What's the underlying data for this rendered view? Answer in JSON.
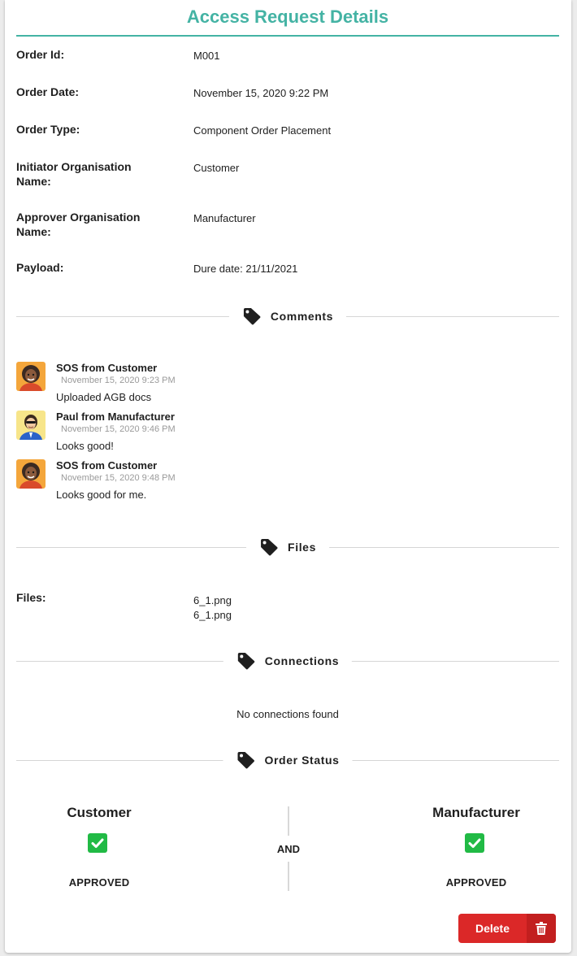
{
  "page": {
    "title": "Access Request Details"
  },
  "details": [
    {
      "label": "Order Id:",
      "value": "M001"
    },
    {
      "label": "Order Date:",
      "value": "November 15, 2020 9:22 PM"
    },
    {
      "label": "Order Type:",
      "value": "Component Order Placement"
    },
    {
      "label": "Initiator Organisation Name:",
      "value": "Customer"
    },
    {
      "label": "Approver Organisation Name:",
      "value": "Manufacturer"
    },
    {
      "label": "Payload:",
      "value": "Dure date: 21/11/2021"
    }
  ],
  "comments_section": {
    "label": "Comments",
    "icon": "tag-icon",
    "items": [
      {
        "author": "SOS from Customer",
        "date": "November 15, 2020 9:23 PM",
        "text": "Uploaded AGB docs",
        "avatar": "avatar-customer"
      },
      {
        "author": "Paul from Manufacturer",
        "date": "November 15, 2020 9:46 PM",
        "text": "Looks good!",
        "avatar": "avatar-manufacturer"
      },
      {
        "author": "SOS from Customer",
        "date": "November 15, 2020 9:48 PM",
        "text": "Looks good for me.",
        "avatar": "avatar-customer"
      }
    ]
  },
  "files_section": {
    "label": "Files",
    "icon": "tag-icon",
    "field_label": "Files:",
    "items": [
      "6_1.png",
      "6_1.png"
    ]
  },
  "connections_section": {
    "label": "Connections",
    "icon": "tag-icon",
    "empty_text": "No connections found"
  },
  "status_section": {
    "label": "Order Status",
    "icon": "tag-icon",
    "joiner": "AND",
    "parties": [
      {
        "name": "Customer",
        "status": "APPROVED",
        "icon": "checkbox-checked-icon"
      },
      {
        "name": "Manufacturer",
        "status": "APPROVED",
        "icon": "checkbox-checked-icon"
      }
    ]
  },
  "actions": {
    "delete_label": "Delete",
    "delete_icon": "trash-icon"
  },
  "colors": {
    "accent": "#44b3a4",
    "approved": "#21ba45",
    "danger": "#db2828"
  }
}
